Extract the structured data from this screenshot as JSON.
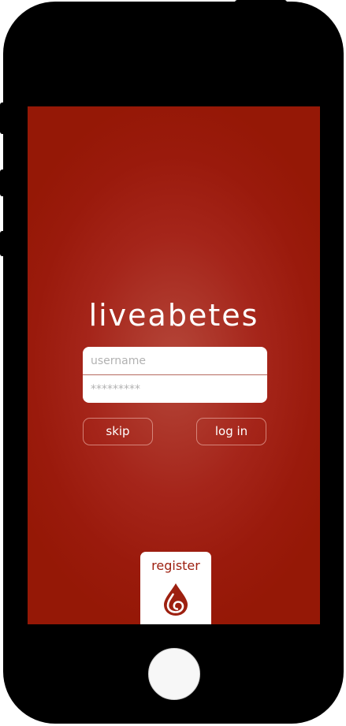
{
  "app": {
    "title": "liveabetes"
  },
  "login_form": {
    "username_placeholder": "username",
    "password_placeholder": "*********"
  },
  "actions": {
    "skip_label": "skip",
    "login_label": "log in"
  },
  "register": {
    "label": "register",
    "icon": "blood-drop-icon"
  },
  "colors": {
    "screen_background": "#9a1a0c",
    "accent": "#9d2010",
    "text_on_accent": "#ffffff",
    "device_frame": "#000000"
  }
}
